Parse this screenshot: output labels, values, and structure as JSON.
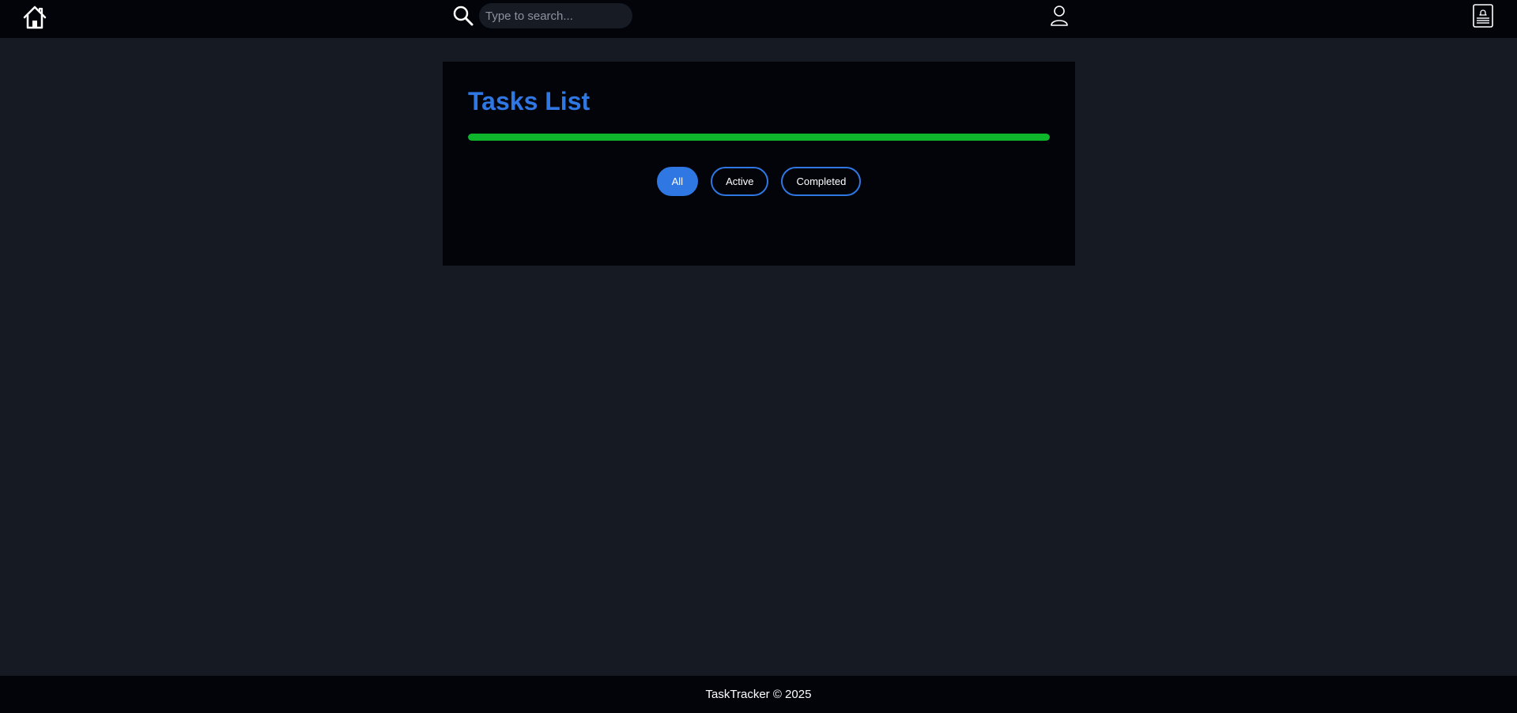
{
  "navbar": {
    "home_icon": "home-icon",
    "search_icon": "search-icon",
    "search_placeholder": "Type to search...",
    "search_value": "",
    "user_icon": "user-icon",
    "notes_icon": "notes-icon"
  },
  "tasks": {
    "title": "Tasks List",
    "progress_fraction": 1.0,
    "filters": [
      {
        "label": "All",
        "selected": true
      },
      {
        "label": "Active",
        "selected": false
      },
      {
        "label": "Completed",
        "selected": false
      }
    ]
  },
  "footer": {
    "text": "TaskTracker © 2025"
  },
  "colors": {
    "accent": "#2f77e2",
    "progress": "#0db62a",
    "navbar_bg": "#02040a",
    "page_bg": "#161a22"
  }
}
